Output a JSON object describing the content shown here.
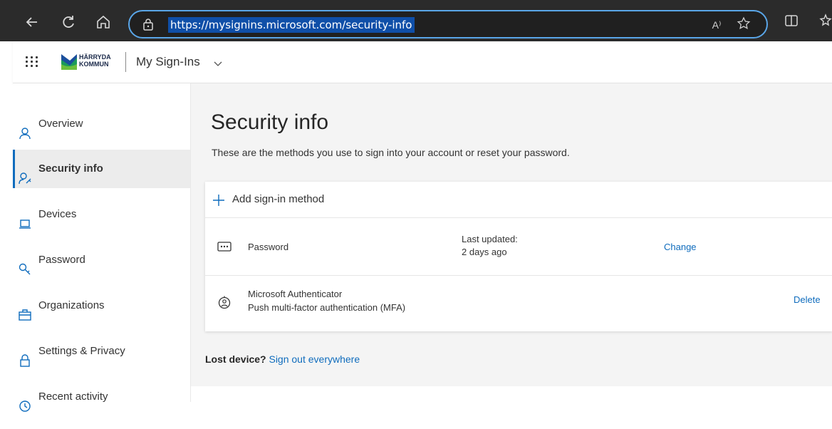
{
  "browser": {
    "url": "https://mysignins.microsoft.com/security-info",
    "read_aloud_glyph": "A⁾"
  },
  "header": {
    "org_logo_text_line1": "HÄRRYDA",
    "org_logo_text_line2": "KOMMUN",
    "app_title": "My Sign-Ins"
  },
  "sidebar": {
    "items": [
      {
        "label": "Overview",
        "icon": "person-icon",
        "selected": false
      },
      {
        "label": "Security info",
        "icon": "person-key-icon",
        "selected": true
      },
      {
        "label": "Devices",
        "icon": "laptop-icon",
        "selected": false
      },
      {
        "label": "Password",
        "icon": "key-icon",
        "selected": false
      },
      {
        "label": "Organizations",
        "icon": "briefcase-icon",
        "selected": false
      },
      {
        "label": "Settings & Privacy",
        "icon": "lock-icon",
        "selected": false
      },
      {
        "label": "Recent activity",
        "icon": "history-icon",
        "selected": false
      }
    ]
  },
  "main": {
    "title": "Security info",
    "description": "These are the methods you use to sign into your account or reset your password.",
    "add_method_label": "Add sign-in method",
    "methods": [
      {
        "name": "Password",
        "icon": "password-dots-icon",
        "updated_label": "Last updated:",
        "updated_value": "2 days ago",
        "action": "Change"
      },
      {
        "name": "Microsoft Authenticator",
        "subtitle": "Push multi-factor authentication (MFA)",
        "icon": "authenticator-icon",
        "action": "Delete"
      }
    ],
    "lost_device_label": "Lost device?",
    "sign_out_link": "Sign out everywhere"
  },
  "colors": {
    "accent": "#0f6cbd",
    "browser_chrome": "#2b2b2b",
    "url_highlight": "#0f4fa8",
    "address_border": "#5aa6e8"
  }
}
